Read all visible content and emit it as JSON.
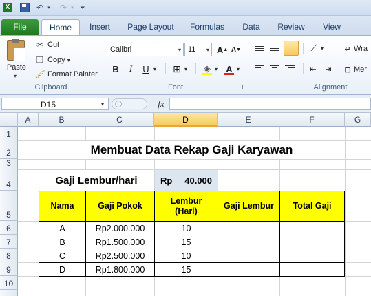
{
  "qat": {
    "icons": [
      "excel-icon",
      "save-icon",
      "undo-icon",
      "redo-icon",
      "customize-icon"
    ]
  },
  "tabs": [
    "File",
    "Home",
    "Insert",
    "Page Layout",
    "Formulas",
    "Data",
    "Review",
    "View"
  ],
  "ribbon": {
    "clipboard": {
      "paste": "Paste",
      "cut": "Cut",
      "copy": "Copy",
      "format_painter": "Format Painter",
      "group": "Clipboard"
    },
    "font": {
      "name": "Calibri",
      "size": "11",
      "group": "Font",
      "bold": "B",
      "italic": "I",
      "underline": "U",
      "grow": "A",
      "shrink": "A",
      "font_color_letter": "A"
    },
    "alignment": {
      "group": "Alignment",
      "wrap": "Wra",
      "merge": "Mer"
    }
  },
  "formula_bar": {
    "name_box": "D15",
    "fx": "fx",
    "formula": ""
  },
  "columns": [
    "A",
    "B",
    "C",
    "D",
    "E",
    "F",
    "G"
  ],
  "selected_column": "D",
  "rows": [
    "1",
    "2",
    "3",
    "4",
    "5",
    "6",
    "7",
    "8",
    "9",
    "10"
  ],
  "sheet": {
    "title": "Membuat Data Rekap Gaji Karyawan",
    "overtime_label": "Gaji Lembur/hari",
    "overtime_currency": "Rp",
    "overtime_value": "40.000",
    "headers": [
      "Nama",
      "Gaji Pokok",
      "Lembur\n(Hari)",
      "Gaji Lembur",
      "Total Gaji"
    ],
    "table": [
      [
        "A",
        "Rp2.000.000",
        "10",
        "",
        ""
      ],
      [
        "B",
        "Rp1.500.000",
        "15",
        "",
        ""
      ],
      [
        "C",
        "Rp2.500.000",
        "10",
        "",
        ""
      ],
      [
        "D",
        "Rp1.800.000",
        "15",
        "",
        ""
      ]
    ]
  },
  "colors": {
    "header_fill": "#ffff00",
    "selected_column": "#f7c95d",
    "file_tab": "#2a8a2a",
    "highlight_cell": "#dce6f1"
  }
}
